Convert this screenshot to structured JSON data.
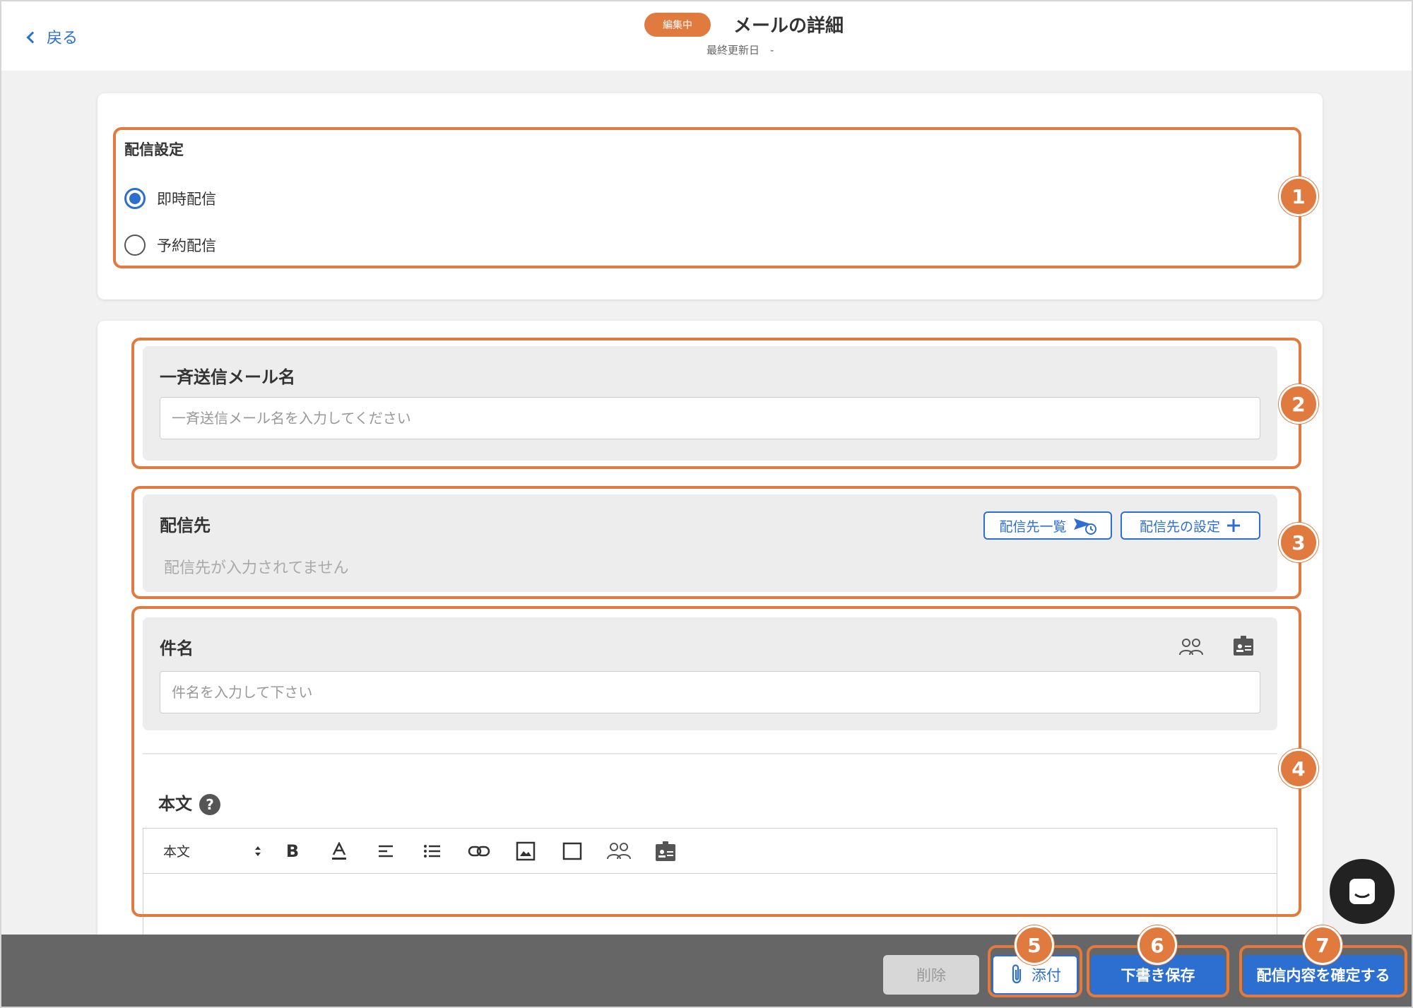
{
  "header": {
    "back_label": "戻る",
    "status": "編集中",
    "title": "メールの詳細",
    "last_updated": "最終更新日　-"
  },
  "delivery_settings": {
    "label": "配信設定",
    "options": [
      {
        "label": "即時配信",
        "selected": true
      },
      {
        "label": "予約配信",
        "selected": false
      }
    ]
  },
  "mail_name": {
    "label": "一斉送信メール名",
    "placeholder": "一斉送信メール名を入力してください",
    "value": ""
  },
  "recipients": {
    "label": "配信先",
    "list_button": "配信先一覧",
    "settings_button": "配信先の設定",
    "empty_text": "配信先が入力されてません"
  },
  "subject": {
    "label": "件名",
    "placeholder": "件名を入力して下さい",
    "value": "",
    "icons": [
      "group-icon",
      "contact-card-icon"
    ]
  },
  "body": {
    "label": "本文",
    "help": "?",
    "format_select": "本文",
    "toolbar_icons": [
      "bold-icon",
      "text-color-icon",
      "align-left-icon",
      "list-icon",
      "link-icon",
      "image-icon",
      "box-icon",
      "group-icon",
      "contact-card-icon"
    ]
  },
  "annotations": [
    "1",
    "2",
    "3",
    "4",
    "5",
    "6",
    "7"
  ],
  "footer": {
    "delete": "削除",
    "attach": "添付",
    "draft": "下書き保存",
    "confirm": "配信内容を確定する"
  },
  "colors": {
    "accent": "#2c6fd1",
    "annotation": "#e07a3f",
    "footer_bg": "#666666"
  }
}
